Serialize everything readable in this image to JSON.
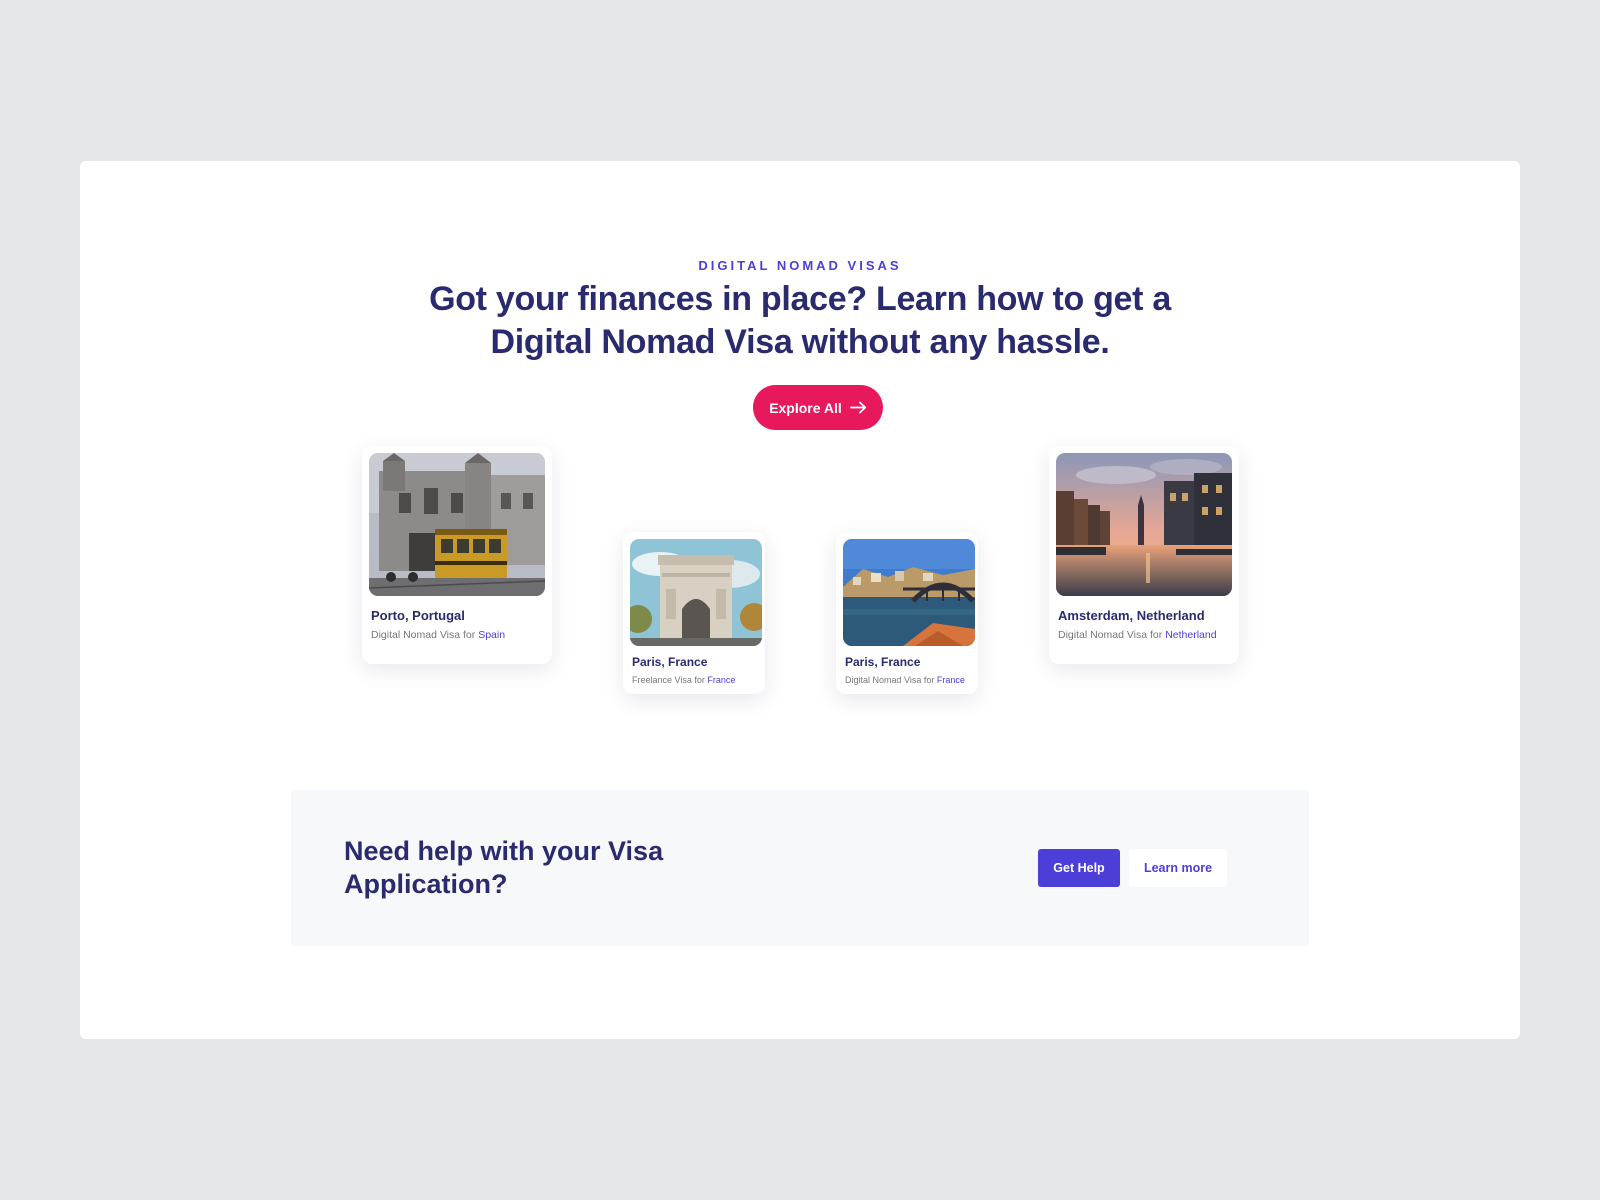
{
  "hero": {
    "eyebrow": "DIGITAL NOMAD VISAS",
    "headline_line1": "Got your finances in place? Learn how to get a",
    "headline_line2": "Digital Nomad Visa without any hassle.",
    "cta_label": "Explore All"
  },
  "cards": [
    {
      "city": "Porto, Portugal",
      "visa_prefix": "Digital Nomad Visa for ",
      "country": "Spain",
      "image": "porto-church-tram"
    },
    {
      "city": "Paris, France",
      "visa_prefix": "Freelance Visa for ",
      "country": "France",
      "image": "arc-de-triomphe"
    },
    {
      "city": "Paris, France",
      "visa_prefix": "Digital Nomad Visa for ",
      "country": "France",
      "image": "river-bridge-city"
    },
    {
      "city": "Amsterdam, Netherland",
      "visa_prefix": "Digital Nomad Visa for ",
      "country": "Netherland",
      "image": "amsterdam-canal-sunset"
    }
  ],
  "help": {
    "title_line1": "Need help with your Visa",
    "title_line2": "Application?",
    "primary_label": "Get Help",
    "secondary_label": "Learn more"
  },
  "colors": {
    "accent": "#4b3fd8",
    "cta": "#e8185c",
    "heading": "#2a2a6f",
    "outer_bg": "#e6e7eb",
    "panel_bg": "#f7f8fa"
  }
}
